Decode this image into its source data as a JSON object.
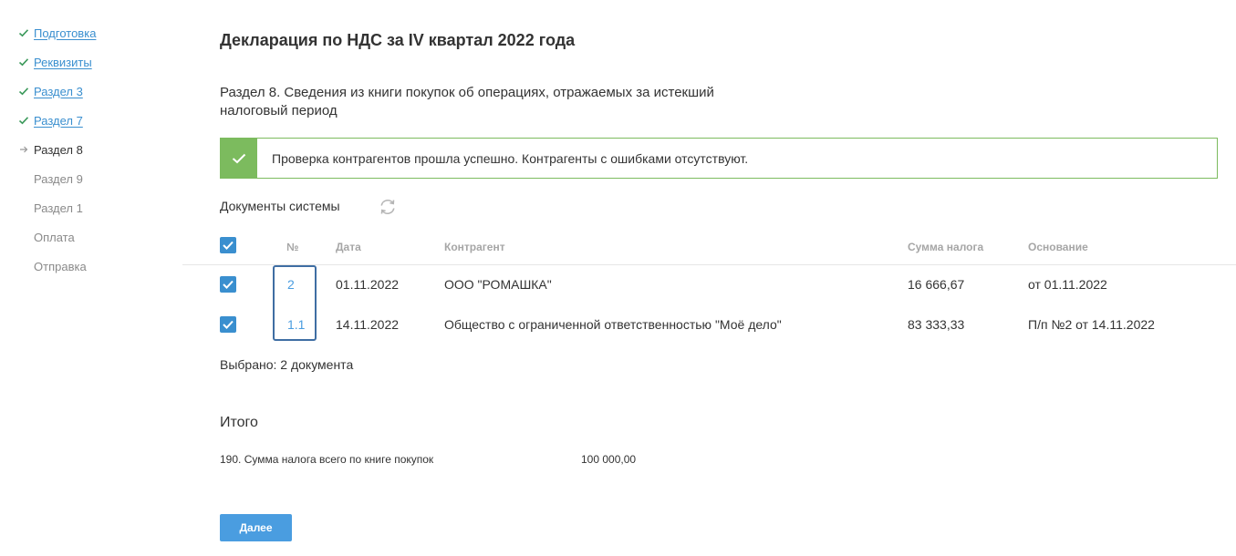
{
  "sidebar": {
    "items": [
      {
        "label": "Подготовка",
        "state": "done"
      },
      {
        "label": "Реквизиты",
        "state": "done"
      },
      {
        "label": "Раздел 3",
        "state": "done"
      },
      {
        "label": "Раздел 7",
        "state": "done"
      },
      {
        "label": "Раздел 8",
        "state": "current"
      },
      {
        "label": "Раздел 9",
        "state": "pending"
      },
      {
        "label": "Раздел 1",
        "state": "pending"
      },
      {
        "label": "Оплата",
        "state": "pending"
      },
      {
        "label": "Отправка",
        "state": "pending"
      }
    ]
  },
  "page": {
    "title": "Декларация по НДС за IV квартал 2022 года",
    "section_title": "Раздел 8. Сведения из книги покупок об операциях, отражаемых за истекший налоговый период"
  },
  "alert": {
    "text": "Проверка контрагентов прошла успешно. Контрагенты с ошибками отсутствуют.",
    "color": "#7cbb5e",
    "icon": "check-icon"
  },
  "documents": {
    "title": "Документы системы",
    "refresh_icon": "refresh-icon",
    "columns": {
      "number": "№",
      "date": "Дата",
      "counterparty": "Контрагент",
      "tax_amount": "Сумма налога",
      "basis": "Основание"
    },
    "rows": [
      {
        "checked": true,
        "number": "2",
        "date": "01.11.2022",
        "counterparty": "ООО \"РОМАШКА\"",
        "tax_amount": "16 666,67",
        "basis": "от 01.11.2022"
      },
      {
        "checked": true,
        "number": "1.1",
        "date": "14.11.2022",
        "counterparty": "Общество с ограниченной ответственностью \"Моё дело\"",
        "tax_amount": "83 333,33",
        "basis": "П/п №2 от 14.11.2022"
      }
    ],
    "selected_text": "Выбрано: 2 документа"
  },
  "totals": {
    "title": "Итого",
    "line_label": "190. Сумма налога всего по книге покупок",
    "line_value": "100 000,00"
  },
  "actions": {
    "next_label": "Далее"
  },
  "colors": {
    "accent": "#3a8fcf",
    "success": "#7cbb5e",
    "highlight_border": "#3f6ea3"
  }
}
